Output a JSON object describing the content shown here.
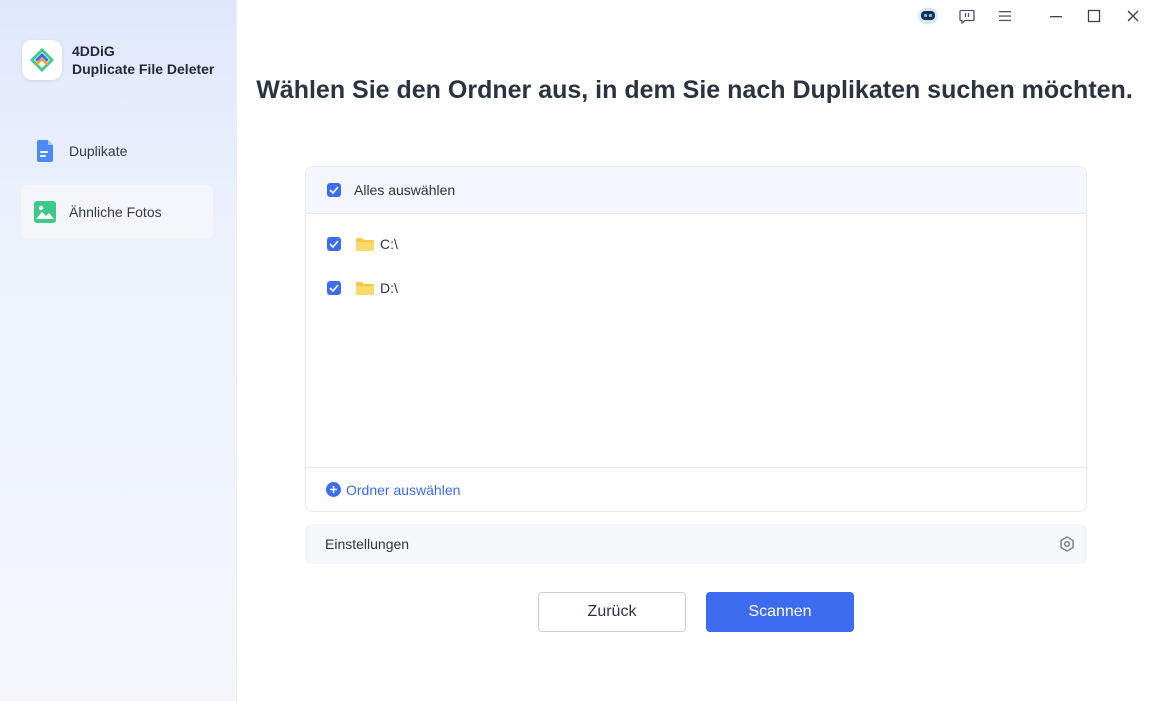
{
  "app": {
    "brand_line1": "4DDiG",
    "brand_line2": "Duplicate File Deleter"
  },
  "sidebar": {
    "items": [
      {
        "label": "Duplikate",
        "icon": "document-icon",
        "active": false
      },
      {
        "label": "Ähnliche Fotos",
        "icon": "photo-icon",
        "active": true
      }
    ]
  },
  "titlebar": {
    "icons": [
      "assistant-robot-icon",
      "feedback-icon",
      "menu-icon",
      "minimize-icon",
      "maximize-icon",
      "close-icon"
    ]
  },
  "main": {
    "heading": "Wählen Sie den Ordner aus, in dem Sie nach Duplikaten suchen möchten.",
    "select_all_label": "Alles auswählen",
    "select_all_checked": true,
    "folders": [
      {
        "name": "C:\\",
        "checked": true
      },
      {
        "name": "D:\\",
        "checked": true
      }
    ],
    "add_folder_label": "Ordner auswählen",
    "settings_label": "Einstellungen",
    "back_label": "Zurück",
    "scan_label": "Scannen"
  },
  "colors": {
    "accent": "#3d6cf0",
    "folder": "#f7c948",
    "sidebar_top": "#dfe8fb"
  }
}
